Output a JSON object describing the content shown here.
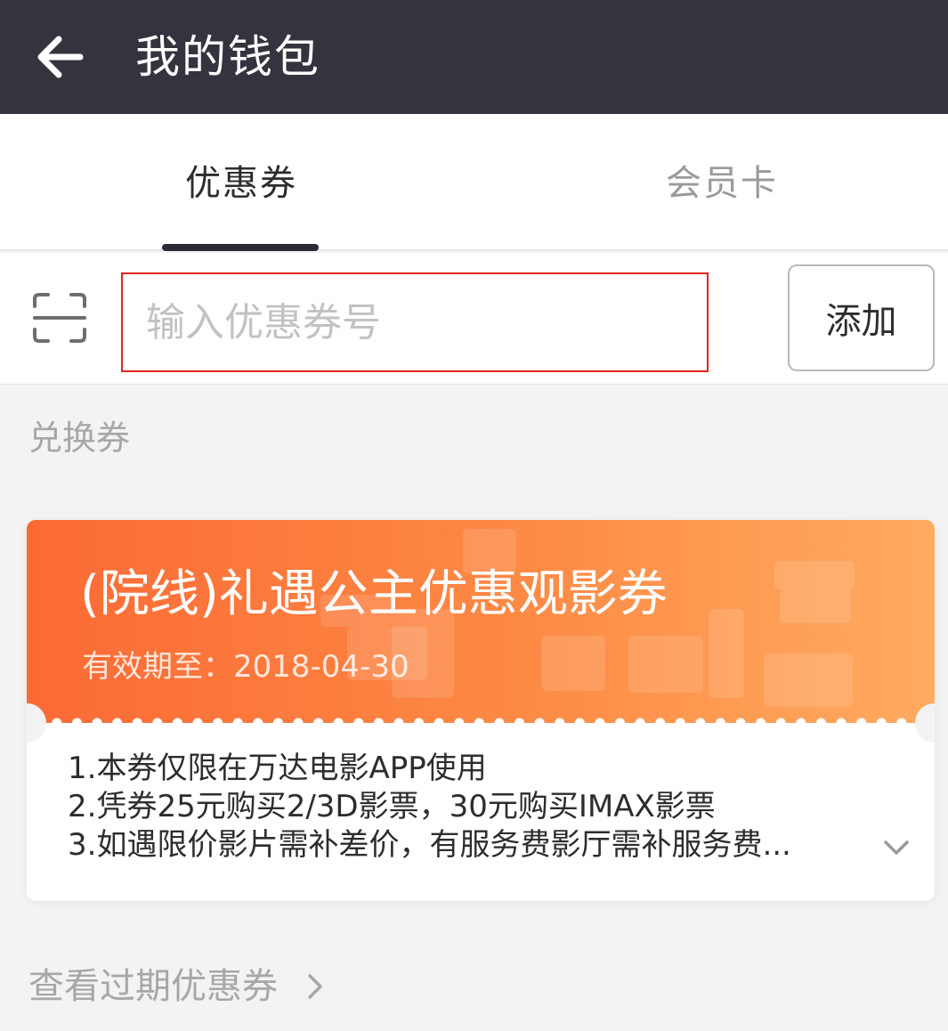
{
  "header": {
    "title": "我的钱包",
    "back_icon": "arrow-left-icon"
  },
  "tabs": [
    {
      "label": "优惠券",
      "active": true
    },
    {
      "label": "会员卡",
      "active": false
    }
  ],
  "coupon_input": {
    "placeholder": "输入优惠券号",
    "value": "",
    "scan_icon": "scan-icon",
    "add_label": "添加"
  },
  "section_title": "兑换券",
  "coupon": {
    "name": "(院线)礼遇公主优惠观影券",
    "expiry": "有效期至：2018-04-30",
    "rules": [
      "1.本券仅限在万达电影APP使用",
      "2.凭券25元购买2/3D影票，30元购买IMAX影票",
      "3.如遇限价影片需补差价，有服务费影厅需补服务费..."
    ],
    "expand_icon": "chevron-down-icon",
    "colors": {
      "gradient_start": "#fb6a35",
      "gradient_end": "#ffab60"
    }
  },
  "expired_link": {
    "label": "查看过期优惠券",
    "icon": "chevron-right-icon"
  },
  "colors": {
    "header_bg": "#34343e",
    "highlight_border": "#e0261f",
    "page_bg": "#f3f3f3"
  }
}
